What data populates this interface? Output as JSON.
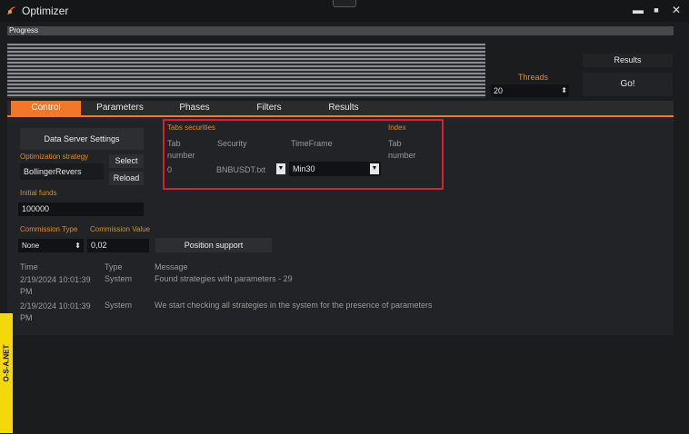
{
  "window": {
    "title": "Optimizer",
    "min": "▬",
    "max": "■",
    "close": "✕"
  },
  "progress": {
    "label": "Progress"
  },
  "threads": {
    "label": "Threads",
    "value": "20"
  },
  "buttons": {
    "results": "Results",
    "go": "Go!"
  },
  "tabs": [
    "Control",
    "Parameters",
    "Phases",
    "Filters",
    "Results"
  ],
  "control": {
    "data_server": "Data Server Settings",
    "strategy_label": "Optimization strategy",
    "strategy_value": "BollingerRevers",
    "select": "Select",
    "reload": "Reload",
    "funds_label": "Initial funds",
    "funds_value": "100000",
    "commission_type_label": "Commission Type",
    "commission_type_value": "None",
    "commission_value_label": "Commission Value",
    "commission_value": "0,02",
    "position_support": "Position support"
  },
  "securities": {
    "title": "Tabs securities",
    "index_title": "Index",
    "col_tab": "Tab number",
    "col_security": "Security",
    "col_timeframe": "TimeFrame",
    "col_index_tab": "Tab number",
    "row": {
      "tab": "0",
      "security": "BNBUSDT.txt",
      "timeframe": "Min30"
    }
  },
  "log": {
    "headers": [
      "Time",
      "Type",
      "Message"
    ],
    "rows": [
      {
        "time": "2/19/2024 10:01:39 PM",
        "type": "System",
        "message": "Found strategies with parameters -  29"
      },
      {
        "time": "2/19/2024 10:01:39 PM",
        "type": "System",
        "message": "We start checking all strategies in the system for the presence of parameters"
      }
    ]
  },
  "side_tab": "O-S-A.NET"
}
